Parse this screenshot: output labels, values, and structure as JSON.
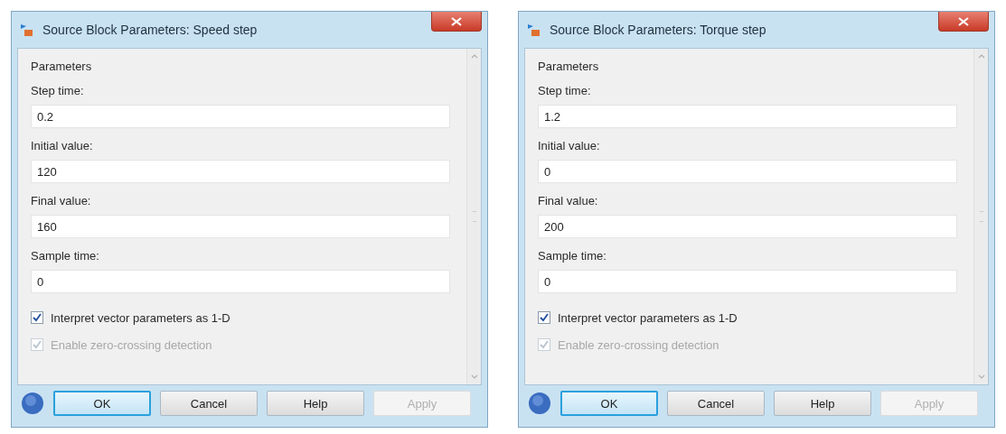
{
  "dialogs": [
    {
      "title": "Source Block Parameters: Speed step",
      "section": "Parameters",
      "params": [
        {
          "label": "Step time:",
          "value": "0.2"
        },
        {
          "label": "Initial value:",
          "value": "120"
        },
        {
          "label": "Final value:",
          "value": "160"
        },
        {
          "label": "Sample time:",
          "value": "0"
        }
      ],
      "checkboxes": [
        {
          "label": "Interpret vector parameters as 1-D",
          "checked": true,
          "disabled": false
        },
        {
          "label": "Enable zero-crossing detection",
          "checked": true,
          "disabled": true
        }
      ],
      "buttons": [
        {
          "label": "OK",
          "default": true,
          "disabled": false
        },
        {
          "label": "Cancel",
          "default": false,
          "disabled": false
        },
        {
          "label": "Help",
          "default": false,
          "disabled": false
        },
        {
          "label": "Apply",
          "default": false,
          "disabled": true
        }
      ]
    },
    {
      "title": "Source Block Parameters: Torque step",
      "section": "Parameters",
      "params": [
        {
          "label": "Step time:",
          "value": "1.2"
        },
        {
          "label": "Initial value:",
          "value": "0"
        },
        {
          "label": "Final value:",
          "value": "200"
        },
        {
          "label": "Sample time:",
          "value": "0"
        }
      ],
      "checkboxes": [
        {
          "label": "Interpret vector parameters as 1-D",
          "checked": true,
          "disabled": false
        },
        {
          "label": "Enable zero-crossing detection",
          "checked": true,
          "disabled": true
        }
      ],
      "buttons": [
        {
          "label": "OK",
          "default": true,
          "disabled": false
        },
        {
          "label": "Cancel",
          "default": false,
          "disabled": false
        },
        {
          "label": "Help",
          "default": false,
          "disabled": false
        },
        {
          "label": "Apply",
          "default": false,
          "disabled": true
        }
      ]
    }
  ]
}
